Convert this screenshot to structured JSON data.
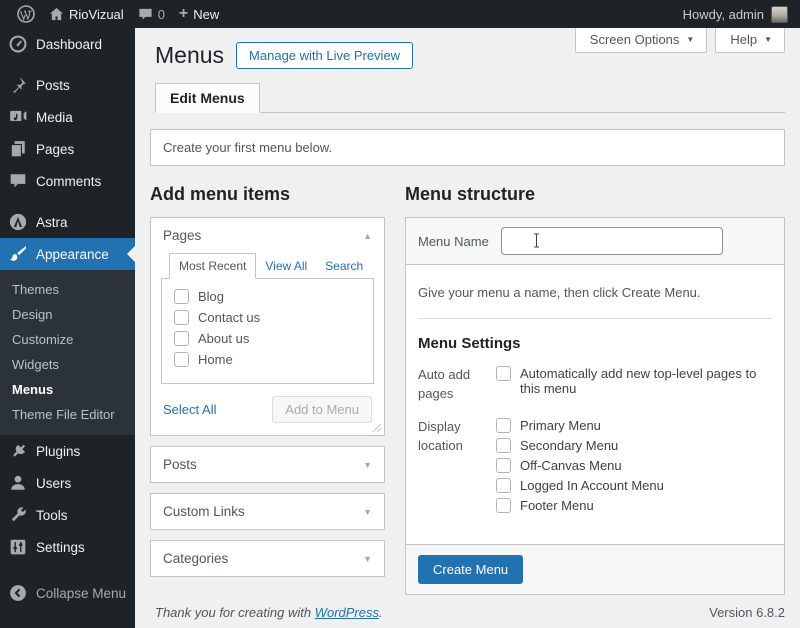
{
  "colors": {
    "accent": "#2271b1",
    "admin_bar_bg": "#1d2327",
    "sidebar_bg": "#1d2327",
    "submenu_bg": "#2c3338",
    "content_bg": "#f0f0f1",
    "box_border": "#c3c4c7",
    "primary_button_bg": "#2271b1"
  },
  "icons": {
    "chevron_up": "▲",
    "chevron_down": "▼",
    "dropdown_caret": "▼",
    "plus": "+"
  },
  "admin_bar": {
    "site_name": "RioVizual",
    "comments_count": "0",
    "new_label": "New",
    "howdy": "Howdy, admin"
  },
  "sidebar": {
    "items": [
      {
        "label": "Dashboard"
      },
      {
        "label": "Posts"
      },
      {
        "label": "Media"
      },
      {
        "label": "Pages"
      },
      {
        "label": "Comments"
      },
      {
        "label": "Astra"
      },
      {
        "label": "Appearance"
      },
      {
        "label": "Plugins"
      },
      {
        "label": "Users"
      },
      {
        "label": "Tools"
      },
      {
        "label": "Settings"
      }
    ],
    "appearance_submenu": [
      {
        "label": "Themes"
      },
      {
        "label": "Design"
      },
      {
        "label": "Customize"
      },
      {
        "label": "Widgets"
      },
      {
        "label": "Menus"
      },
      {
        "label": "Theme File Editor"
      }
    ],
    "current_submenu": "Menus",
    "collapse_label": "Collapse Menu"
  },
  "header": {
    "title": "Menus",
    "manage_button": "Manage with Live Preview",
    "screen_options": "Screen Options",
    "help": "Help"
  },
  "tabs": {
    "edit_menus": "Edit Menus"
  },
  "notice": {
    "text": "Create your first menu below."
  },
  "add_menu_items": {
    "heading": "Add menu items",
    "pages_panel": {
      "title": "Pages",
      "tabs": [
        {
          "label": "Most Recent"
        },
        {
          "label": "View All"
        },
        {
          "label": "Search"
        }
      ],
      "items": [
        {
          "label": "Blog"
        },
        {
          "label": "Contact us"
        },
        {
          "label": "About us"
        },
        {
          "label": "Home"
        }
      ],
      "select_all": "Select All",
      "add_to_menu": "Add to Menu"
    },
    "collapsed_panels": [
      {
        "title": "Posts"
      },
      {
        "title": "Custom Links"
      },
      {
        "title": "Categories"
      }
    ]
  },
  "menu_structure": {
    "heading": "Menu structure",
    "menu_name_label": "Menu Name",
    "menu_name_value": "",
    "hint": "Give your menu a name, then click Create Menu.",
    "settings_heading": "Menu Settings",
    "auto_add_label": "Auto add pages",
    "auto_add_option": "Automatically add new top-level pages to this menu",
    "display_location_label": "Display location",
    "locations": [
      {
        "label": "Primary Menu"
      },
      {
        "label": "Secondary Menu"
      },
      {
        "label": "Off-Canvas Menu"
      },
      {
        "label": "Logged In Account Menu"
      },
      {
        "label": "Footer Menu"
      }
    ],
    "create_button": "Create Menu"
  },
  "footer": {
    "thanks_prefix": "Thank you for creating with ",
    "wordpress_link": "WordPress",
    "thanks_suffix": ".",
    "version": "Version 6.8.2"
  }
}
